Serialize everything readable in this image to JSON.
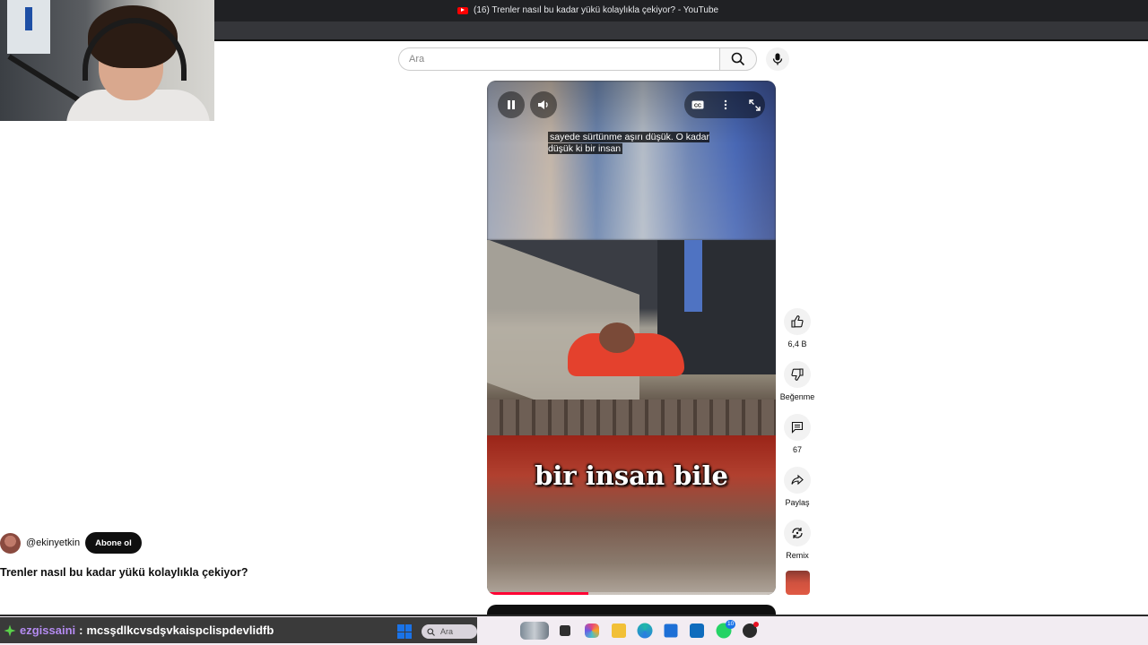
{
  "browser": {
    "tab_title": "(16) Trenler nasıl bu kadar yükü kolaylıkla çekiyor? - YouTube"
  },
  "youtube": {
    "search": {
      "placeholder": "Ara"
    },
    "player": {
      "caption_text": "sayede sürtünme aşırı düşük. O kadar düşük ki bir insan",
      "burned_subtitle": "bir insan bile",
      "progress_fraction": 0.35,
      "accent_color": "#ff0033"
    },
    "actions": {
      "like_count": "6,4 B",
      "dislike_label": "Beğenme",
      "comment_count": "67",
      "share_label": "Paylaş",
      "remix_label": "Remix"
    },
    "channel": {
      "handle": "@ekinyetkin",
      "subscribe_label": "Abone ol"
    },
    "video_title": "Trenler nasıl bu kadar yükü kolaylıkla çekiyor?"
  },
  "stream_overlay": {
    "chat": {
      "username": "ezgissaini",
      "separator": ":",
      "message": "mcsşdlkcvsdşvkaispclispdevlidfb",
      "username_color": "#b48bf0"
    }
  },
  "taskbar": {
    "search_label": "Ara",
    "whatsapp_badge": "10",
    "icons": [
      "windows-logo",
      "search-icon",
      "widgets-icon",
      "file-icon",
      "copilot-icon",
      "folder-icon",
      "edge-icon",
      "store-icon",
      "outlook-icon",
      "whatsapp-icon",
      "obs-icon"
    ]
  }
}
